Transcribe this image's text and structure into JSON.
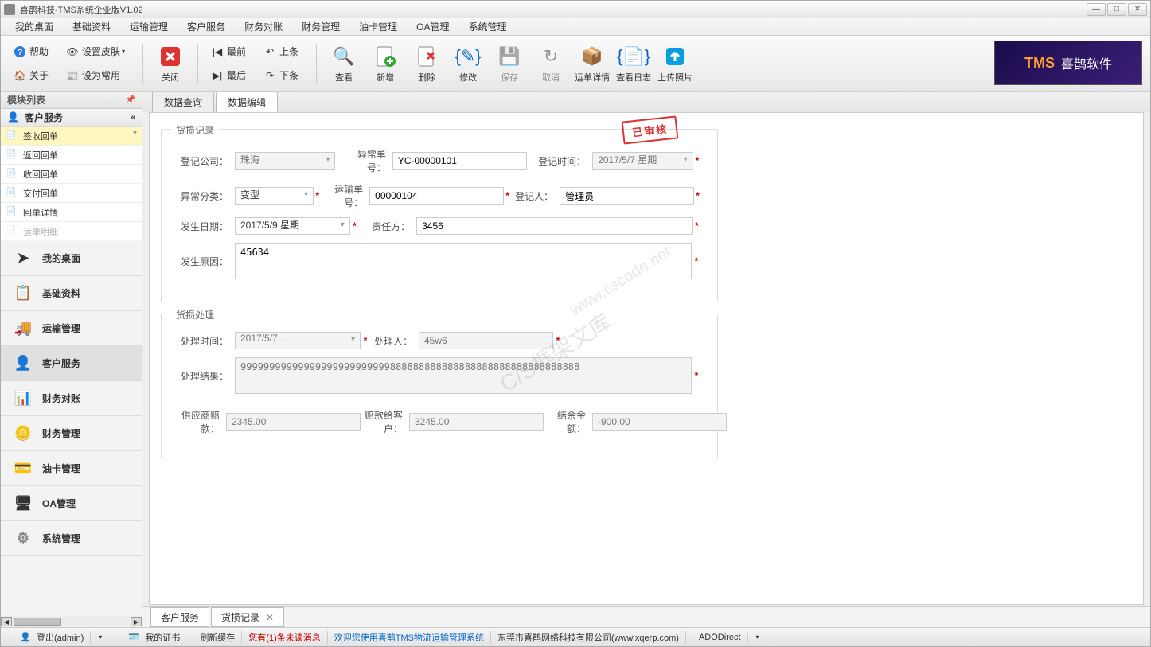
{
  "title": "喜鹊科技-TMS系统企业版V1.02",
  "banner": {
    "label1": "TMS",
    "label2": "喜鹊软件"
  },
  "menu": [
    "我的桌面",
    "基础资料",
    "运输管理",
    "客户服务",
    "财务对账",
    "财务管理",
    "油卡管理",
    "OA管理",
    "系统管理"
  ],
  "toolbar": {
    "help": "帮助",
    "skin": "设置皮肤",
    "about": "关于",
    "setdefault": "设为常用",
    "first": "最前",
    "prev": "上条",
    "last": "最后",
    "next": "下条",
    "close": "关闭",
    "view": "查看",
    "add": "新增",
    "del": "删除",
    "edit": "修改",
    "save": "保存",
    "cancel": "取消",
    "detail": "运单详情",
    "log": "查看日志",
    "upload": "上传照片"
  },
  "sidebar": {
    "header": "模块列表",
    "category": "客户服务",
    "items": [
      "签收回单",
      "返回回单",
      "收回回单",
      "交付回单",
      "回单详情",
      "运单明细"
    ],
    "nav": [
      "我的桌面",
      "基础资料",
      "运输管理",
      "客户服务",
      "财务对账",
      "财务管理",
      "油卡管理",
      "OA管理",
      "系统管理"
    ]
  },
  "tabs": {
    "t1": "数据查询",
    "t2": "数据编辑"
  },
  "stamp": "已审核",
  "group1": {
    "title": "货损记录",
    "company_lbl": "登记公司：",
    "company": "珠海",
    "excno_lbl": "异常单号：",
    "excno": "YC-00000101",
    "regtime_lbl": "登记时间：",
    "regtime": "2017/5/7 星期",
    "exctype_lbl": "异常分类：",
    "exctype": "变型",
    "trno_lbl": "运输单号：",
    "trno": "00000104",
    "reguser_lbl": "登记人：",
    "reguser": "管理员",
    "occdate_lbl": "发生日期：",
    "occdate": "2017/5/9 星期",
    "resp_lbl": "责任方：",
    "resp": "3456",
    "reason_lbl": "发生原因：",
    "reason": "45634"
  },
  "group2": {
    "title": "货损处理",
    "ptime_lbl": "处理时间：",
    "ptime": "2017/5/7 ...",
    "puser_lbl": "处理人：",
    "puser": "45w6",
    "presult_lbl": "处理结果：",
    "presult": "99999999999999999999999999888888888888888888888888888888888",
    "supcomp_lbl": "供应商赔款：",
    "supcomp": "2345.00",
    "custcomp_lbl": "赔款给客户：",
    "custcomp": "3245.00",
    "balance_lbl": "结余金额：",
    "balance": "-900.00"
  },
  "watermark": {
    "a": "C/S框架文库",
    "b": "www.cscode.net"
  },
  "doctabs": {
    "t1": "客户服务",
    "t2": "货损记录"
  },
  "status": {
    "logout": "登出(admin)",
    "cert": "我的证书",
    "refresh": "刷新缓存",
    "unread": "您有(1)条未读消息",
    "welcome": "欢迎您使用喜鹊TMS物流运输管理系统",
    "company": "东莞市喜鹊网络科技有限公司(www.xqerp.com)",
    "db": "ADODirect"
  }
}
